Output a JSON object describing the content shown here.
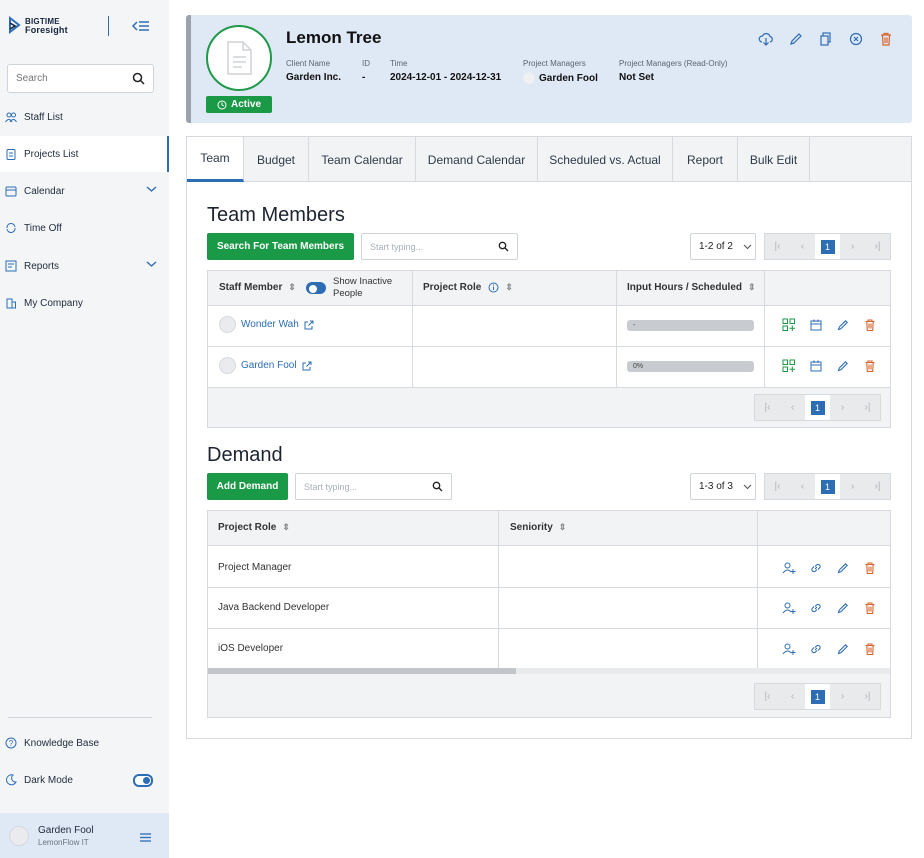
{
  "brand": {
    "line1": "BIGTIME",
    "line2": "Foresight"
  },
  "sidebar": {
    "search_placeholder": "Search",
    "items": [
      {
        "label": "Staff List"
      },
      {
        "label": "Projects List"
      },
      {
        "label": "Calendar"
      },
      {
        "label": "Time Off"
      },
      {
        "label": "Reports"
      },
      {
        "label": "My Company"
      }
    ],
    "knowledge_base": "Knowledge Base",
    "dark_mode": "Dark Mode",
    "user": {
      "name": "Garden Fool",
      "company": "LemonFlow IT"
    }
  },
  "project": {
    "title": "Lemon Tree",
    "status": "Active",
    "client_label": "Client Name",
    "client": "Garden Inc.",
    "id_label": "ID",
    "id": "-",
    "time_label": "Time",
    "time": "2024-12-01 - 2024-12-31",
    "pm_label": "Project Managers",
    "pm": "Garden Fool",
    "pm_ro_label": "Project Managers (Read-Only)",
    "pm_ro": "Not Set"
  },
  "tabs": [
    "Team",
    "Budget",
    "Team Calendar",
    "Demand Calendar",
    "Scheduled vs. Actual",
    "Report",
    "Bulk Edit"
  ],
  "team": {
    "title": "Team Members",
    "search_button": "Search For Team Members",
    "search_placeholder": "Start typing...",
    "pager_label": "1-2 of 2",
    "page": "1",
    "columns": {
      "staff": "Staff Member",
      "show_inactive": "Show Inactive People",
      "role": "Project Role",
      "hours": "Input Hours / Scheduled"
    },
    "rows": [
      {
        "name": "Wonder Wah",
        "role": "",
        "hours": "-"
      },
      {
        "name": "Garden Fool",
        "role": "",
        "hours": "0%"
      }
    ]
  },
  "demand": {
    "title": "Demand",
    "add_button": "Add Demand",
    "search_placeholder": "Start typing...",
    "pager_label": "1-3 of 3",
    "page": "1",
    "columns": {
      "role": "Project Role",
      "seniority": "Seniority"
    },
    "rows": [
      {
        "role": "Project Manager",
        "seniority": ""
      },
      {
        "role": "Java Backend Developer",
        "seniority": ""
      },
      {
        "role": "iOS Developer",
        "seniority": ""
      }
    ]
  },
  "colors": {
    "primary": "#2d6db5",
    "green": "#1a9a46",
    "danger": "#d9622b",
    "header_bg": "#dfe8f5"
  }
}
